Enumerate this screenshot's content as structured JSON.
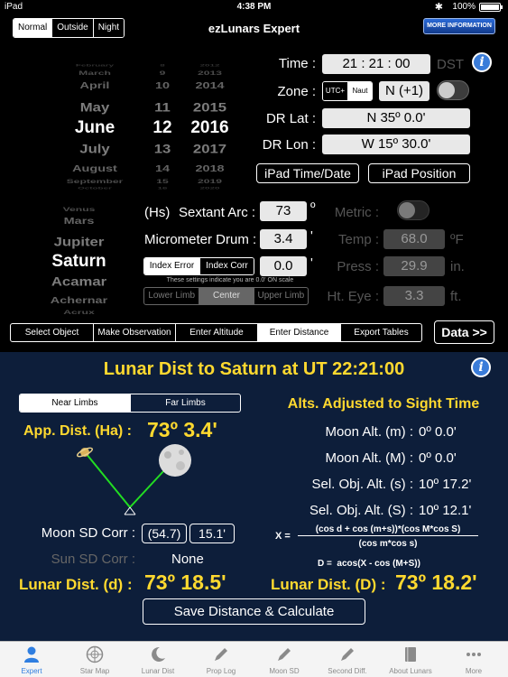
{
  "status": {
    "device": "iPad",
    "time": "4:38 PM",
    "battery": "100%",
    "battery_level": 1.0
  },
  "header": {
    "modes": [
      "Normal",
      "Outside",
      "Night"
    ],
    "selected_mode": "Normal",
    "title": "ezLunars Expert",
    "more_info": "MORE INFORMATION"
  },
  "date_picker": {
    "months": [
      "February",
      "March",
      "April",
      "May",
      "June",
      "July",
      "August",
      "September",
      "October"
    ],
    "days": [
      "8",
      "9",
      "10",
      "11",
      "12",
      "13",
      "14",
      "15",
      "16"
    ],
    "years": [
      "2012",
      "2013",
      "2014",
      "2015",
      "2016",
      "2017",
      "2018",
      "2019",
      "2020"
    ],
    "selected": {
      "month": "June",
      "day": "12",
      "year": "2016"
    }
  },
  "time": {
    "label": "Time :",
    "value": "21 : 21 : 00",
    "dst": "DST"
  },
  "zone": {
    "label": "Zone :",
    "utc_option": "UTC+",
    "naut_option": "Naut",
    "value": "N (+1)"
  },
  "dr_lat": {
    "label": "DR Lat :",
    "value": "N 35º 0.0'"
  },
  "dr_lon": {
    "label": "DR Lon :",
    "value": "W 15º 30.0'"
  },
  "buttons": {
    "ipad_time": "iPad Time/Date",
    "ipad_position": "iPad Position"
  },
  "objects": [
    "Venus",
    "Mars",
    "Jupiter",
    "Saturn",
    "Acamar",
    "Achernar",
    "Acrux"
  ],
  "selected_object": "Saturn",
  "sextant": {
    "hs": "(Hs)",
    "label": "Sextant Arc :",
    "value": "73",
    "unit": "º"
  },
  "micrometer": {
    "label": "Micrometer Drum :",
    "value": "3.4",
    "unit": "'"
  },
  "index": {
    "error_label": "Index Error",
    "corr_label": "Index Corr",
    "value": "0.0",
    "unit": "'",
    "note": "These settings indicate you are 0.0' ON scale"
  },
  "limb": {
    "options": [
      "Lower Limb",
      "Center",
      "Upper Limb"
    ],
    "selected": "Center"
  },
  "metric": {
    "label": "Metric :"
  },
  "temp": {
    "label": "Temp :",
    "value": "68.0",
    "unit": "ºF"
  },
  "press": {
    "label": "Press :",
    "value": "29.9",
    "unit": "in."
  },
  "ht_eye": {
    "label": "Ht. Eye :",
    "value": "3.3",
    "unit": "ft."
  },
  "nav_tabs": {
    "items": [
      "Select Object",
      "Make Observation",
      "Enter Altitude",
      "Enter Distance",
      "Export Tables"
    ],
    "selected": "Enter Distance",
    "data_button": "Data >>"
  },
  "panel": {
    "title": "Lunar Dist to Saturn at UT 22:21:00",
    "limb_options": [
      "Near Limbs",
      "Far Limbs"
    ],
    "selected_limb": "Near Limbs",
    "app_dist_label": "App. Dist. (Ha) :",
    "app_dist_value": "73º 3.4'",
    "moon_sd_label": "Moon SD Corr :",
    "moon_sd_value1": "(54.7)",
    "moon_sd_value2": "15.1'",
    "sun_sd_label": "Sun SD Corr :",
    "sun_sd_value": "None",
    "lunar_d_label": "Lunar Dist. (d) :",
    "lunar_d_value": "73º 18.5'",
    "alts_title": "Alts. Adjusted to Sight Time",
    "alts": [
      {
        "label": "Moon Alt. (m) :",
        "value": "0º 0.0'"
      },
      {
        "label": "Moon Alt. (M) :",
        "value": "0º 0.0'"
      },
      {
        "label": "Sel. Obj. Alt. (s) :",
        "value": "10º 17.2'"
      },
      {
        "label": "Sel. Obj. Alt. (S) :",
        "value": "10º 12.1'"
      }
    ],
    "formula_x": "X =",
    "formula_num": "(cos d + cos (m+s))*(cos M*cos S)",
    "formula_den": "(cos m*cos s)",
    "formula_d": "D =  acos(X - cos (M+S))",
    "lunar_D_label": "Lunar Dist. (D) :",
    "lunar_D_value": "73º 18.2'",
    "save_button": "Save Distance & Calculate"
  },
  "tabbar": {
    "items": [
      "Expert",
      "Star Map",
      "Lunar Dist",
      "Prop Log",
      "Moon SD",
      "Second Diff.",
      "About Lunars",
      "More"
    ],
    "selected": "Expert"
  },
  "colors": {
    "accent": "#2f7ee0",
    "highlight": "#ffd92f",
    "panel": "#0d1e3a"
  }
}
